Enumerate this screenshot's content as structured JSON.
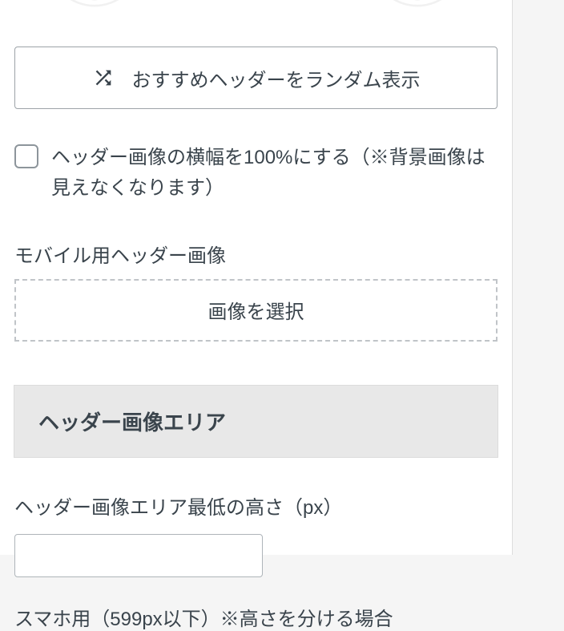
{
  "buttons": {
    "random_header": "おすすめヘッダーをランダム表示",
    "select_image": "画像を選択"
  },
  "checkbox": {
    "full_width_label": "ヘッダー画像の横幅を100%にする（※背景画像は見えなくなります）"
  },
  "labels": {
    "mobile_header_image": "モバイル用ヘッダー画像",
    "header_area_section": "ヘッダー画像エリア",
    "min_height": "ヘッダー画像エリア最低の高さ（px）",
    "sp_height": "スマホ用（599px以下）※高さを分ける場合"
  },
  "inputs": {
    "min_height_value": ""
  }
}
